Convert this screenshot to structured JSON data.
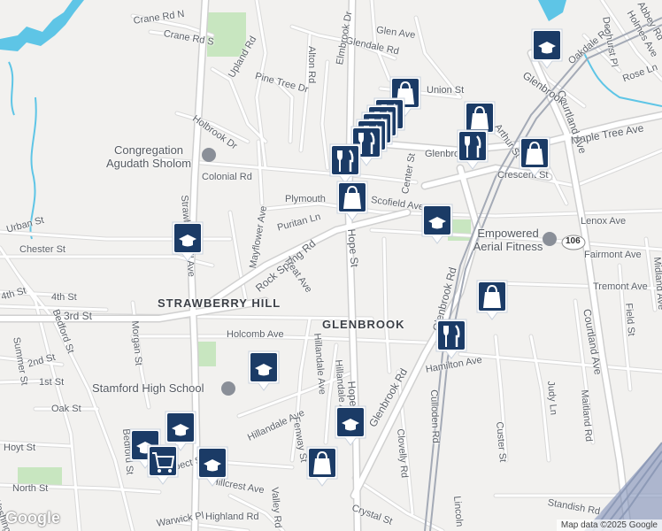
{
  "map": {
    "title": "",
    "colors": {
      "road": "#ffffff",
      "road_outline": "#d7d7d7",
      "water": "#5ec5e6",
      "park": "#c8e6c0",
      "rail": "#9aa0ad",
      "marker": "#1b3b66",
      "land": "#f2f1ef"
    },
    "street_labels": [
      "Crane Rd N",
      "Crane Rd S",
      "Glen Ave",
      "Glendale Rd",
      "Alton Rd",
      "Upland Rd",
      "Pine Tree Dr",
      "Elmbrook Dr",
      "Union St",
      "Holbrook Dr",
      "Colonial Rd",
      "Plymouth",
      "Glenbrook Rd",
      "Scofield Ave",
      "Center St",
      "Crescent St",
      "Arthur St",
      "Maple Tree Ave",
      "Lenox Ave",
      "Fairmont Ave",
      "Tremont Ave",
      "Urban St",
      "Chester St",
      "Puritan Ln",
      "Mayflower Ave",
      "Strawberry Hill Ave",
      "Rock Spring Rd",
      "Treat Ave",
      "Hope St",
      "Glenbrook Rd",
      "4th St",
      "4th St",
      "3rd St",
      "Holcomb Ave",
      "Hamilton Ave",
      "2nd St",
      "1st St",
      "Oak St",
      "Hoyt St",
      "North St",
      "Hillandale Ave",
      "Hillandale Ave",
      "Fenway St",
      "Hope St",
      "Glenbrook Rd",
      "Clovelly Rd",
      "Culloden Rd",
      "Custer St",
      "Judy Ln",
      "Maitland Rd",
      "Field St",
      "Midland Ave",
      "Courtland Ave",
      "Courtland Ave",
      "Hillcrest Ave",
      "Crystal St",
      "Standish Rd",
      "Highland Rd",
      "Prospect St",
      "Bedford St",
      "Bedford St",
      "Summer St",
      "Morgan St",
      "Denhurst Pl",
      "Holmes Ave",
      "Rose Ln",
      "Oakdale Rd",
      "Glenbrook",
      "Abbey Rd",
      "Lincoln",
      "Valley Rd",
      "Warwick Pl",
      "Washington",
      "Hillandale Ave"
    ],
    "area_labels": [
      "STRAWBERRY HILL",
      "GLENBROOK"
    ],
    "poi_labels": [
      "Congregation Agudath Sholom",
      "Empowered Aerial Fitness",
      "Stamford High School"
    ],
    "route_shield": "106",
    "markers": [
      {
        "icon": "school-icon"
      },
      {
        "icon": "shopping-bag-icon"
      },
      {
        "icon": "restaurant-icon"
      },
      {
        "icon": "restaurant-icon"
      },
      {
        "icon": "restaurant-icon"
      },
      {
        "icon": "restaurant-icon"
      },
      {
        "icon": "restaurant-icon"
      },
      {
        "icon": "restaurant-icon"
      },
      {
        "icon": "shopping-bag-icon"
      },
      {
        "icon": "shopping-bag-icon"
      },
      {
        "icon": "restaurant-icon"
      },
      {
        "icon": "shopping-bag-icon"
      },
      {
        "icon": "school-icon"
      },
      {
        "icon": "school-icon"
      },
      {
        "icon": "shopping-bag-icon"
      },
      {
        "icon": "restaurant-icon"
      },
      {
        "icon": "school-icon"
      },
      {
        "icon": "school-icon"
      },
      {
        "icon": "school-icon"
      },
      {
        "icon": "school-icon"
      },
      {
        "icon": "shopping-cart-icon"
      },
      {
        "icon": "shopping-bag-icon"
      },
      {
        "icon": "school-icon"
      }
    ],
    "credit": "Map data ©2025 Google",
    "logo": "Google"
  }
}
